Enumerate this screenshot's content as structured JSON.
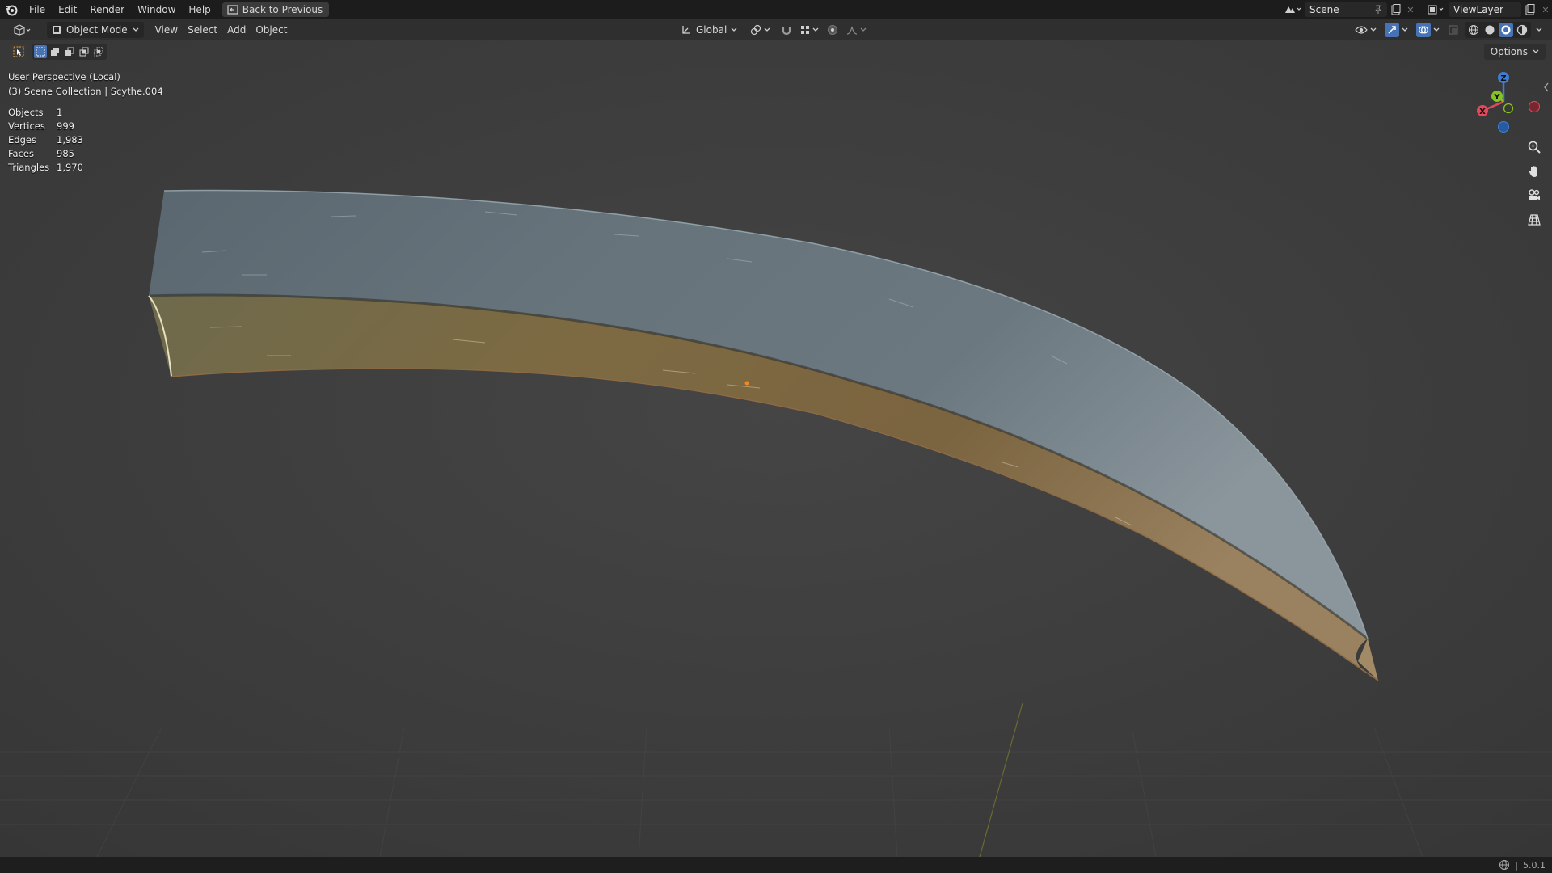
{
  "topbar": {
    "menus": [
      "File",
      "Edit",
      "Render",
      "Window",
      "Help"
    ],
    "back_button": "Back to Previous",
    "scene_name": "Scene",
    "view_layer": "ViewLayer"
  },
  "viewport_header": {
    "mode": "Object Mode",
    "menus": [
      "View",
      "Select",
      "Add",
      "Object"
    ],
    "transform_orientation": "Global"
  },
  "viewport": {
    "perspective": "User Perspective (Local)",
    "collection": "(3) Scene Collection | Scythe.004",
    "options_label": "Options",
    "stats": [
      {
        "label": "Objects",
        "value": "1"
      },
      {
        "label": "Vertices",
        "value": "999"
      },
      {
        "label": "Edges",
        "value": "1,983"
      },
      {
        "label": "Faces",
        "value": "985"
      },
      {
        "label": "Triangles",
        "value": "1,970"
      }
    ],
    "gizmo": {
      "x_label": "X",
      "y_label": "Y",
      "z_label": "Z"
    }
  },
  "statusbar": {
    "version": "5.0.1"
  },
  "colors": {
    "axis_x": "#e24a5c",
    "axis_y": "#86c31e",
    "axis_z": "#3d7fd8",
    "blade_steel": "#5d6a72",
    "blade_bronze": "#7a6438"
  }
}
